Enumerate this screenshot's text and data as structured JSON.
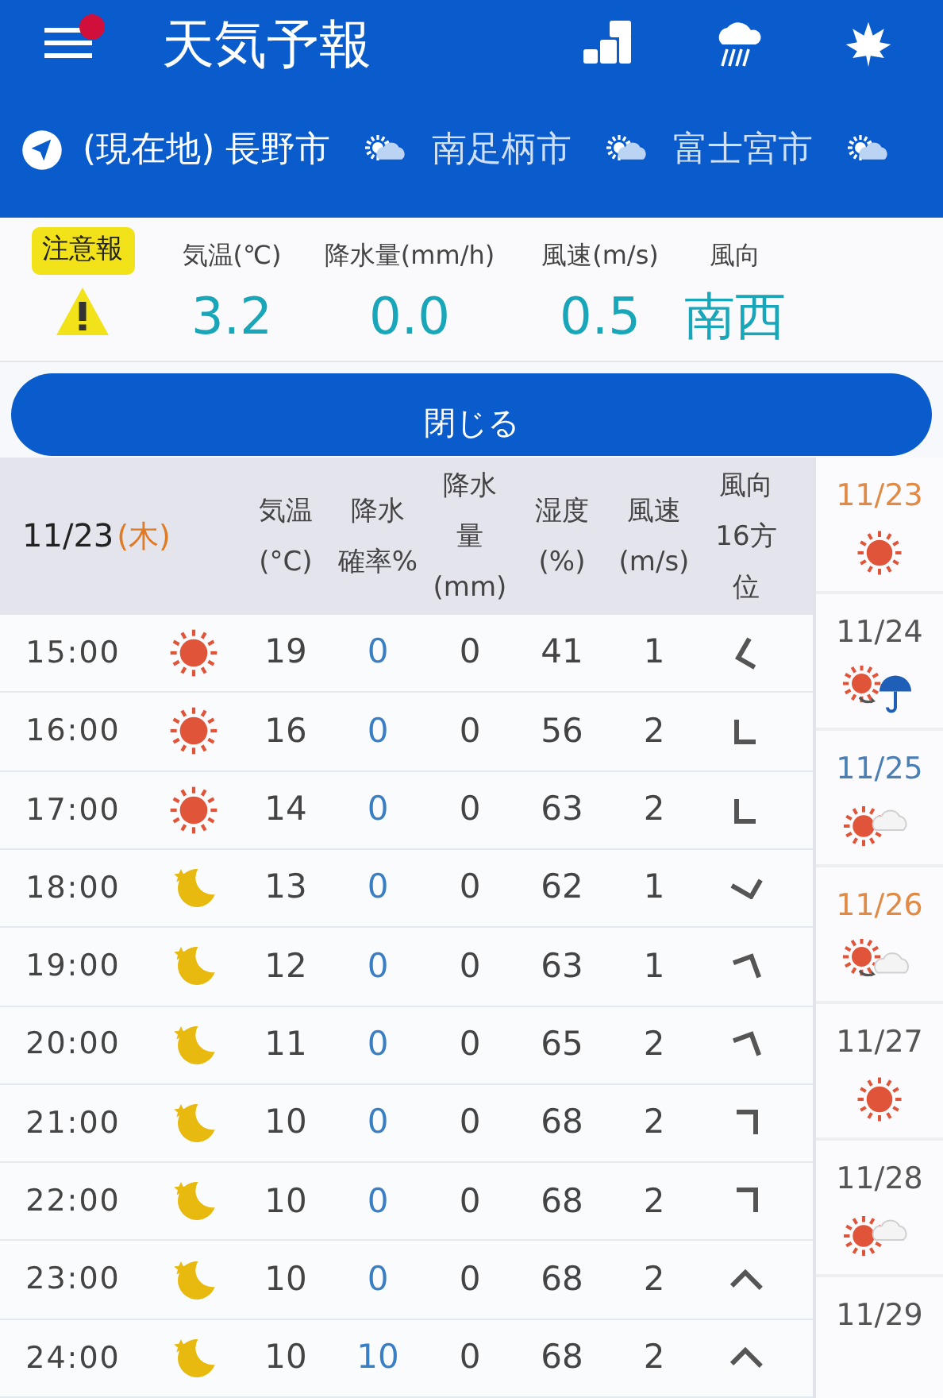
{
  "header": {
    "menu_notification": true,
    "title": "天気予報"
  },
  "locations": [
    {
      "label": "(現在地) 長野市",
      "kind": "current",
      "selected": true
    },
    {
      "label": "南足柄市",
      "kind": "saved",
      "selected": false
    },
    {
      "label": "富士宮市",
      "kind": "saved",
      "selected": false
    }
  ],
  "current": {
    "alert": "注意報",
    "stats": [
      {
        "label": "気温(℃)",
        "value": "3.2"
      },
      {
        "label": "降水量(mm/h)",
        "value": "0.0"
      },
      {
        "label": "風速(m/s)",
        "value": "0.5"
      },
      {
        "label": "風向",
        "value": "南西"
      }
    ]
  },
  "close_button": "閉じる",
  "table": {
    "date": "11/23",
    "weekday": "(木)",
    "columns": [
      [
        "気温",
        "(°C)"
      ],
      [
        "降水",
        "確率%"
      ],
      [
        "降水",
        "量",
        "(mm)"
      ],
      [
        "湿度",
        "(%)"
      ],
      [
        "風速",
        "(m/s)"
      ],
      [
        "風向",
        "16方",
        "位"
      ]
    ],
    "rows": [
      {
        "time": "15:00",
        "icon": {
          "kind": "sunny"
        },
        "temp": "19",
        "prob": "0",
        "amount": "0",
        "humidity": "41",
        "wind": "1",
        "wind_arrow": {
          "kind": "wnw"
        }
      },
      {
        "time": "16:00",
        "icon": {
          "kind": "sunny"
        },
        "temp": "16",
        "prob": "0",
        "amount": "0",
        "humidity": "56",
        "wind": "2",
        "wind_arrow": {
          "kind": "w"
        }
      },
      {
        "time": "17:00",
        "icon": {
          "kind": "sunny"
        },
        "temp": "14",
        "prob": "0",
        "amount": "0",
        "humidity": "63",
        "wind": "2",
        "wind_arrow": {
          "kind": "w"
        }
      },
      {
        "time": "18:00",
        "icon": {
          "kind": "clear-night"
        },
        "temp": "13",
        "prob": "0",
        "amount": "0",
        "humidity": "62",
        "wind": "1",
        "wind_arrow": {
          "kind": "sw"
        }
      },
      {
        "time": "19:00",
        "icon": {
          "kind": "clear-night"
        },
        "temp": "12",
        "prob": "0",
        "amount": "0",
        "humidity": "63",
        "wind": "1",
        "wind_arrow": {
          "kind": "ese"
        }
      },
      {
        "time": "20:00",
        "icon": {
          "kind": "clear-night"
        },
        "temp": "11",
        "prob": "0",
        "amount": "0",
        "humidity": "65",
        "wind": "2",
        "wind_arrow": {
          "kind": "ese"
        }
      },
      {
        "time": "21:00",
        "icon": {
          "kind": "clear-night"
        },
        "temp": "10",
        "prob": "0",
        "amount": "0",
        "humidity": "68",
        "wind": "2",
        "wind_arrow": {
          "kind": "e"
        }
      },
      {
        "time": "22:00",
        "icon": {
          "kind": "clear-night"
        },
        "temp": "10",
        "prob": "0",
        "amount": "0",
        "humidity": "68",
        "wind": "2",
        "wind_arrow": {
          "kind": "e"
        }
      },
      {
        "time": "23:00",
        "icon": {
          "kind": "clear-night"
        },
        "temp": "10",
        "prob": "0",
        "amount": "0",
        "humidity": "68",
        "wind": "2",
        "wind_arrow": {
          "kind": "ne"
        }
      },
      {
        "time": "24:00",
        "icon": {
          "kind": "clear-night"
        },
        "temp": "10",
        "prob": "10",
        "amount": "0",
        "humidity": "68",
        "wind": "2",
        "wind_arrow": {
          "kind": "ne"
        }
      }
    ]
  },
  "days": [
    {
      "date": "11/23",
      "color": "#e08a45",
      "icon": {
        "kind": "sunny"
      }
    },
    {
      "date": "11/24",
      "color": "#555555",
      "icon": {
        "kind": "sunny-then-rain"
      }
    },
    {
      "date": "11/25",
      "color": "#4a7fb5",
      "icon": {
        "kind": "sunny-cloudy"
      }
    },
    {
      "date": "11/26",
      "color": "#e08a45",
      "icon": {
        "kind": "sunny-then-cloudy"
      }
    },
    {
      "date": "11/27",
      "color": "#555555",
      "icon": {
        "kind": "sunny"
      }
    },
    {
      "date": "11/28",
      "color": "#555555",
      "icon": {
        "kind": "sunny-cloudy"
      }
    },
    {
      "date": "11/29",
      "color": "#555555"
    }
  ]
}
